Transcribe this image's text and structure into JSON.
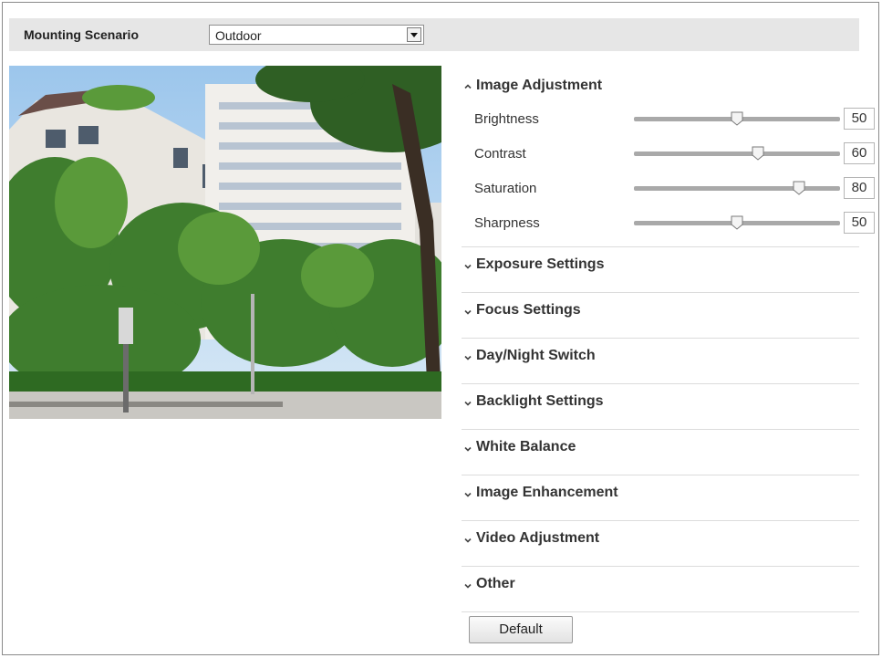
{
  "mounting": {
    "label": "Mounting Scenario",
    "selected": "Outdoor"
  },
  "image_adjustment": {
    "title": "Image Adjustment",
    "expanded": true,
    "sliders": [
      {
        "label": "Brightness",
        "value": "50",
        "percent": 50
      },
      {
        "label": "Contrast",
        "value": "60",
        "percent": 60
      },
      {
        "label": "Saturation",
        "value": "80",
        "percent": 80
      },
      {
        "label": "Sharpness",
        "value": "50",
        "percent": 50
      }
    ]
  },
  "sections": [
    {
      "title": "Exposure Settings"
    },
    {
      "title": "Focus Settings"
    },
    {
      "title": "Day/Night Switch"
    },
    {
      "title": "Backlight Settings"
    },
    {
      "title": "White Balance"
    },
    {
      "title": "Image Enhancement"
    },
    {
      "title": "Video Adjustment"
    },
    {
      "title": "Other"
    }
  ],
  "buttons": {
    "default_label": "Default"
  },
  "icons": {
    "expanded": "chevron-up-icon",
    "collapsed": "chevron-down-icon",
    "dropdown": "dropdown-arrow-icon"
  },
  "colors": {
    "topbar_bg": "#e6e6e6",
    "track": "#a9a9a9",
    "divider": "#dcdcdc"
  }
}
